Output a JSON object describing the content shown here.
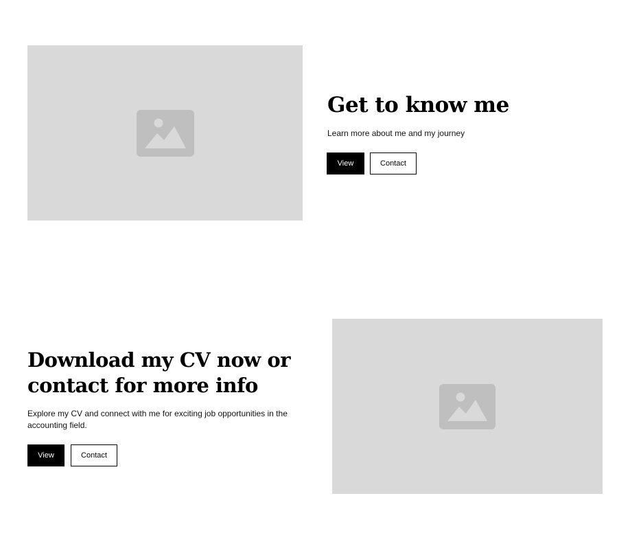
{
  "sections": [
    {
      "title": "Get to know me",
      "description": "Learn more about me and my journey",
      "image_icon": "image-placeholder-icon",
      "primary_button": "View",
      "secondary_button": "Contact"
    },
    {
      "title": "Download my CV now or contact for more info",
      "description": "Explore my CV and connect with me for exciting job opportunities in the accounting field.",
      "image_icon": "image-placeholder-icon",
      "primary_button": "View",
      "secondary_button": "Contact"
    }
  ],
  "colors": {
    "placeholder_bg": "#d9d9d9",
    "placeholder_icon": "#bfbfbf",
    "primary_button_bg": "#000000",
    "primary_button_text": "#ffffff"
  }
}
